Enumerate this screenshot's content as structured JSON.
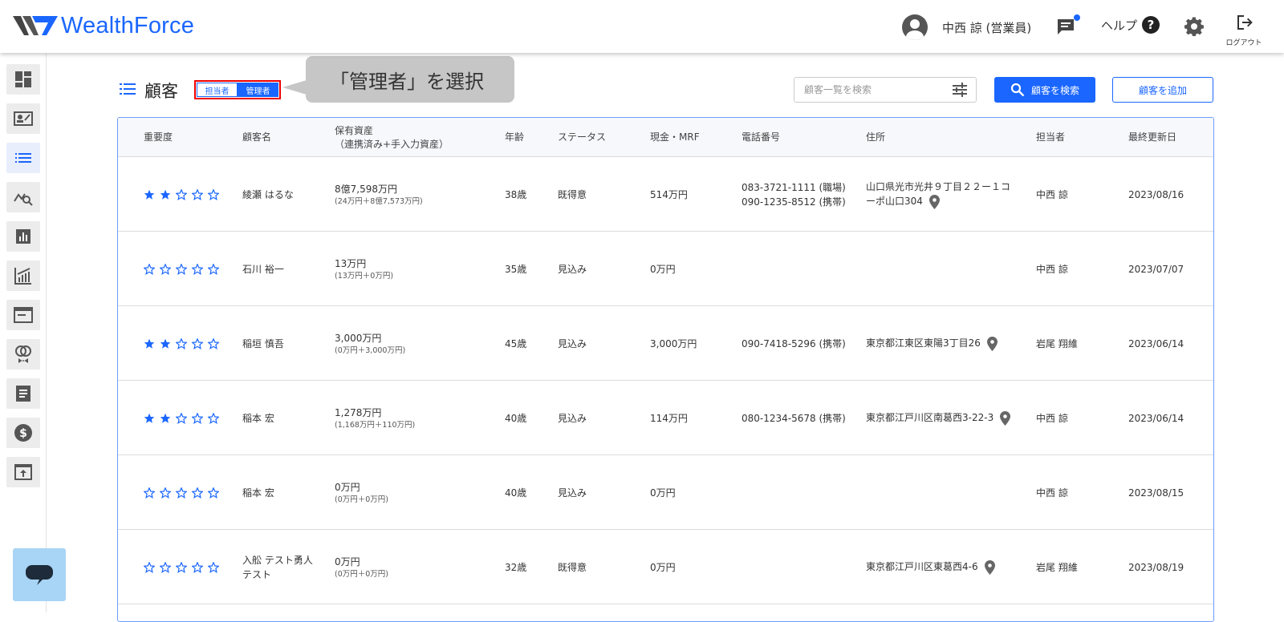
{
  "header": {
    "logo_text": "WealthForce",
    "user_name": "中西 諒 (営業員)",
    "help_label": "ヘルプ",
    "help_symbol": "?",
    "logout_label": "ログアウト",
    "brand_color": "#1a66ff"
  },
  "sidebar": {
    "items": [
      "dashboard-icon",
      "contact-card-icon",
      "list-icon",
      "analysis-search-icon",
      "bar-chart-icon",
      "growth-chart-icon",
      "window-icon",
      "rings-icon",
      "document-icon",
      "dollar-icon",
      "upload-icon"
    ],
    "active_index": 2
  },
  "page": {
    "title": "顧客",
    "toggle": {
      "option1": "担当者",
      "option2": "管理者",
      "selected": "管理者"
    },
    "callout": "「管理者」を選択",
    "search_placeholder": "顧客一覧を検索",
    "search_button": "顧客を検索",
    "add_button": "顧客を追加"
  },
  "table": {
    "headers": {
      "importance": "重要度",
      "name": "顧客名",
      "assets_line1": "保有資産",
      "assets_line2": "（連携済み+手入力資産）",
      "age": "年齢",
      "status": "ステータス",
      "cash": "現金・MRF",
      "phone": "電話番号",
      "address": "住所",
      "owner": "担当者",
      "updated": "最終更新日"
    },
    "rows": [
      {
        "stars": 2,
        "name": "綾瀬 はるな",
        "assets": "8億7,598万円",
        "assets_detail": "(24万円＋8億7,573万円)",
        "age": "38歳",
        "status": "既得意",
        "cash": "514万円",
        "phone1": "083-3721-1111 (職場)",
        "phone2": "090-1235-8512 (携帯)",
        "address1": "山口県光市光井９丁目２２ー１コ",
        "address2": "ーポ山口304",
        "owner": "中西 諒",
        "updated": "2023/08/16"
      },
      {
        "stars": 0,
        "name": "石川 裕一",
        "assets": "13万円",
        "assets_detail": "(13万円＋0万円)",
        "age": "35歳",
        "status": "見込み",
        "cash": "0万円",
        "phone1": "",
        "phone2": "",
        "address1": "",
        "address2": "",
        "owner": "中西 諒",
        "updated": "2023/07/07"
      },
      {
        "stars": 2,
        "name": "稲垣 慎吾",
        "assets": "3,000万円",
        "assets_detail": "(0万円＋3,000万円)",
        "age": "45歳",
        "status": "見込み",
        "cash": "3,000万円",
        "phone1": "090-7418-5296 (携帯)",
        "phone2": "",
        "address1": "東京都江東区東陽3丁目26",
        "address2": "",
        "owner": "岩尾 翔維",
        "updated": "2023/06/14"
      },
      {
        "stars": 2,
        "name": "稲本 宏",
        "assets": "1,278万円",
        "assets_detail": "(1,168万円＋110万円)",
        "age": "40歳",
        "status": "見込み",
        "cash": "114万円",
        "phone1": "080-1234-5678 (携帯)",
        "phone2": "",
        "address1": "東京都江戸川区南葛西3-22-3",
        "address2": "",
        "owner": "中西 諒",
        "updated": "2023/06/14"
      },
      {
        "stars": 0,
        "name": "稲本 宏",
        "assets": "0万円",
        "assets_detail": "(0万円＋0万円)",
        "age": "40歳",
        "status": "見込み",
        "cash": "0万円",
        "phone1": "",
        "phone2": "",
        "address1": "",
        "address2": "",
        "owner": "中西 諒",
        "updated": "2023/08/15"
      },
      {
        "stars": 0,
        "name": "入舩 テスト勇人テスト",
        "name_line1": "入舩 テスト勇人",
        "name_line2": "テスト",
        "assets": "0万円",
        "assets_detail": "(0万円＋0万円)",
        "age": "32歳",
        "status": "既得意",
        "cash": "0万円",
        "phone1": "",
        "phone2": "",
        "address1": "東京都江戸川区東葛西4-6",
        "address2": "",
        "owner": "岩尾 翔維",
        "updated": "2023/08/19"
      }
    ]
  }
}
